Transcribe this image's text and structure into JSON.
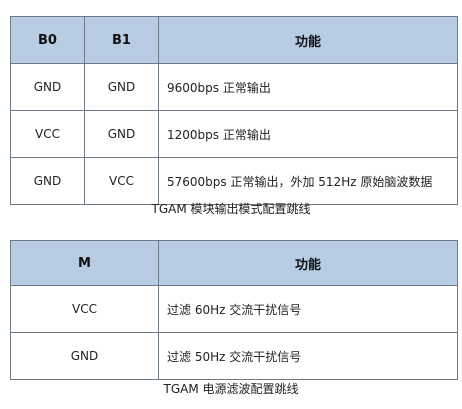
{
  "table1": {
    "headers": [
      "B0",
      "B1",
      "功能"
    ],
    "rows": [
      [
        "GND",
        "GND",
        "9600bps   正常输出"
      ],
      [
        "VCC",
        "GND",
        "1200bps   正常输出"
      ],
      [
        "GND",
        "VCC",
        "57600bps 正常输出，外加 512Hz 原始脑波数据"
      ]
    ],
    "caption": "TGAM 模块输出模式配置跳线"
  },
  "table2": {
    "headers": [
      "M",
      "功能"
    ],
    "rows": [
      [
        "VCC",
        "过滤 60Hz 交流干扰信号"
      ],
      [
        "GND",
        "过滤 50Hz 交流干扰信号"
      ]
    ],
    "caption": "TGAM 电源滤波配置跳线"
  },
  "colors": {
    "header_bg": "#b8cce4",
    "border": "#6e7a86"
  }
}
